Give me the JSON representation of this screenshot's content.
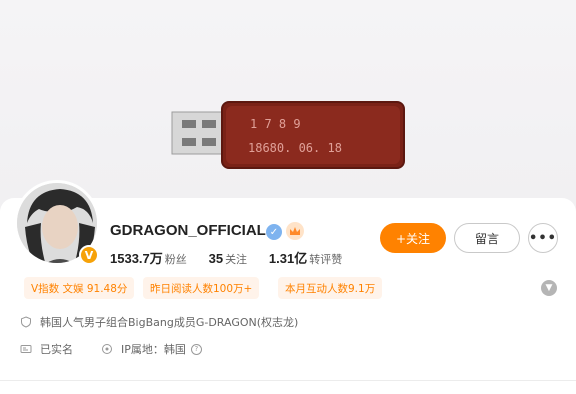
{
  "profile": {
    "name": "GDRAGON_OFFICIAL",
    "avatar_badge": "V",
    "verified_icon": "verified-check-icon",
    "crown_icon": "crown-icon"
  },
  "cover": {
    "usb_text_line1": "1  7  8  9",
    "usb_text_line2": "18680. 06. 18"
  },
  "stats": [
    {
      "value": "1533.7万",
      "label": "粉丝"
    },
    {
      "value": "35",
      "label": "关注"
    },
    {
      "value": "1.31亿",
      "label": "转评赞"
    }
  ],
  "actions": {
    "follow": "+关注",
    "message": "留言",
    "more": "•••"
  },
  "tags": [
    "V指数 文娱 91.48分",
    "昨日阅读人数100万+",
    "本月互动人数9.1万"
  ],
  "info": {
    "bio": "韩国人气男子组合BigBang成员G-DRAGON(权志龙)",
    "realname": "已实名",
    "ip": "IP属地：韩国"
  },
  "colors": {
    "accent": "#ff8200",
    "tag_bg": "#fff3ea",
    "verified": "#7eb3ef"
  }
}
